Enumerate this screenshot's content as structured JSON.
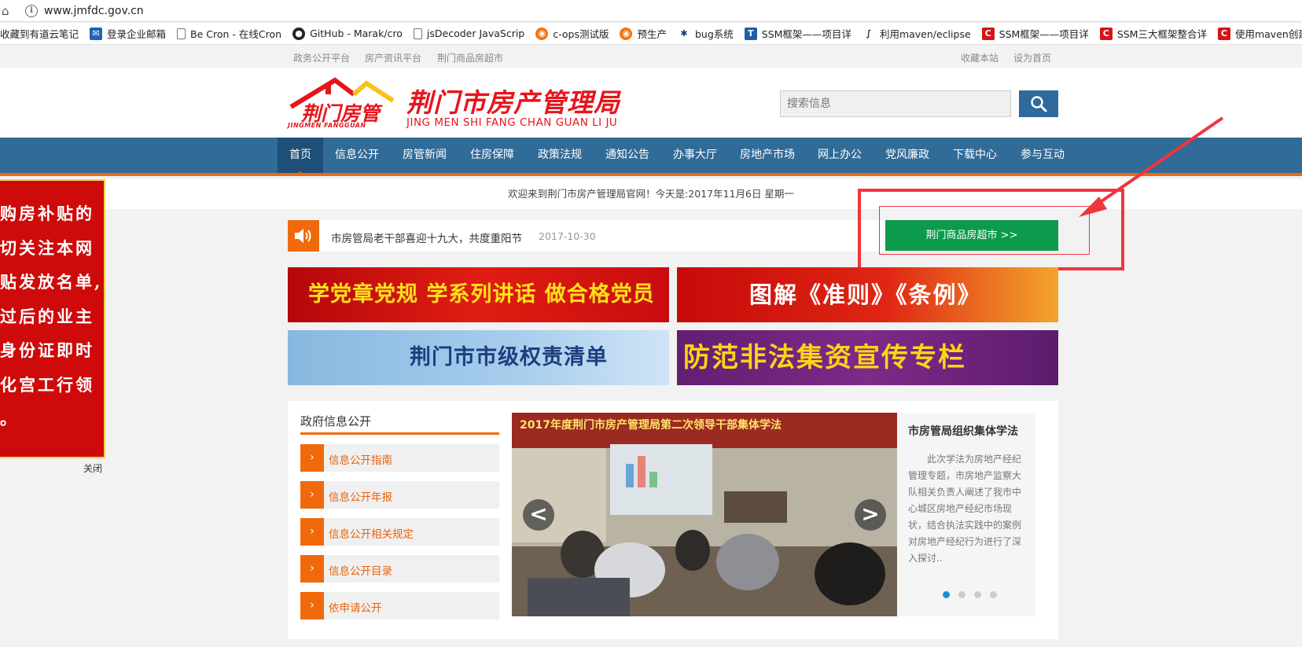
{
  "browser": {
    "url": "www.jmfdc.gov.cn",
    "bookmarks": [
      {
        "label": "收藏到有道云笔记",
        "icon": "youdao-icon"
      },
      {
        "label": "登录企业邮箱",
        "icon": "mail-icon"
      },
      {
        "label": "Be Cron - 在线Cron",
        "icon": "page-icon"
      },
      {
        "label": "GitHub - Marak/cro",
        "icon": "github-icon"
      },
      {
        "label": "jsDecoder JavaScrip",
        "icon": "page-icon"
      },
      {
        "label": "c-ops测试版",
        "icon": "ops-icon"
      },
      {
        "label": "预生产",
        "icon": "ops-icon"
      },
      {
        "label": "bug系统",
        "icon": "bug-icon"
      },
      {
        "label": "SSM框架——项目详",
        "icon": "t-icon"
      },
      {
        "label": "利用maven/eclipse",
        "icon": "maven-icon"
      },
      {
        "label": "SSM框架——项目详",
        "icon": "csdn-icon"
      },
      {
        "label": "SSM三大框架整合详",
        "icon": "csdn-icon"
      },
      {
        "label": "使用maven创建web",
        "icon": "csdn-icon"
      }
    ]
  },
  "toplinks": {
    "left": [
      "政务公开平台",
      "房产资讯平台",
      "荆门商品房超市"
    ],
    "right": [
      "收藏本站",
      "设为首页"
    ]
  },
  "header": {
    "logo_small": "荆门房管",
    "logo_small_py": "JINGMEN FANGGUAN",
    "logo_title": "荆门市房产管理局",
    "logo_pinyin": "JING MEN SHI FANG CHAN GUAN LI JU",
    "search_placeholder": "搜索信息"
  },
  "nav": [
    "首页",
    "信息公开",
    "房管新闻",
    "住房保障",
    "政策法规",
    "通知公告",
    "办事大厅",
    "房地产市场",
    "网上办公",
    "党风廉政",
    "下载中心",
    "参与互动"
  ],
  "welcome": "欢迎来到荆门市房产管理局官网！今天是:2017年11月6日 星期一",
  "ad": {
    "lines": [
      "购房补贴的",
      "切关注本网",
      "贴发放名单,",
      "过后的业主",
      "身份证即时",
      "化宫工行领",
      "。"
    ],
    "close": "关闭"
  },
  "news": {
    "text": "市房管局老干部喜迎十九大，共度重阳节",
    "date": "2017-10-30"
  },
  "market_button": "荆门商品房超市 >>",
  "banners": [
    "学党章党规 学系列讲话 做合格党员",
    "图解《准则》《条例》",
    "荆门市市级权责清单",
    "防范非法集资宣传专栏"
  ],
  "info_section": {
    "title": "政府信息公开",
    "items": [
      "信息公开指南",
      "信息公开年报",
      "信息公开相关规定",
      "信息公开目录",
      "依申请公开"
    ]
  },
  "slider": {
    "photo_banner": "2017年度荆门市房产管理局第二次领导干部集体学法",
    "title": "市房管局组织集体学法",
    "desc": "此次学法为房地产经纪管理专题，市房地产监察大队相关负责人阐述了我市中心城区房地产经纪市场现状，结合执法实践中的案例对房地产经纪行为进行了深入探讨..",
    "prev": "<",
    "next": ">"
  },
  "colors": {
    "nav": "#316b98",
    "accent": "#f06a0d",
    "brand_red": "#e8141c",
    "market_green": "#0c9b4d",
    "annotation": "#f0353c"
  }
}
